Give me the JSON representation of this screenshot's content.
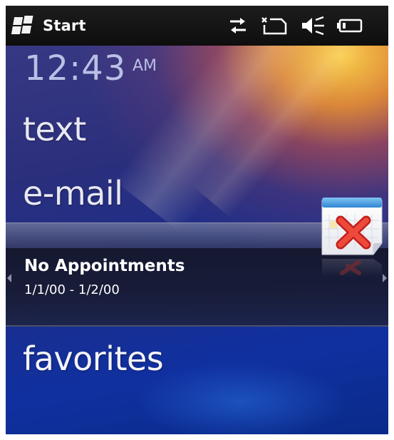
{
  "statusbar": {
    "start_label": "Start",
    "icons": [
      "connectivity-arrows-icon",
      "no-sim-icon",
      "speaker-muted-icon",
      "battery-icon"
    ]
  },
  "today": {
    "clock": {
      "time": "12:43",
      "period": "AM"
    },
    "items": {
      "text": "text",
      "email": "e-mail",
      "favorites": "favorites"
    },
    "calendar": {
      "title": "No Appointments",
      "date_range": "1/1/00 - 1/2/00",
      "icon": "calendar-error-icon"
    }
  },
  "colors": {
    "statusbar_bg": "#111111",
    "clock_color": "#b9bfe6",
    "item_color": "#e8e8f2",
    "accent_orange": "#ffa828",
    "accent_red": "#e0302a"
  }
}
